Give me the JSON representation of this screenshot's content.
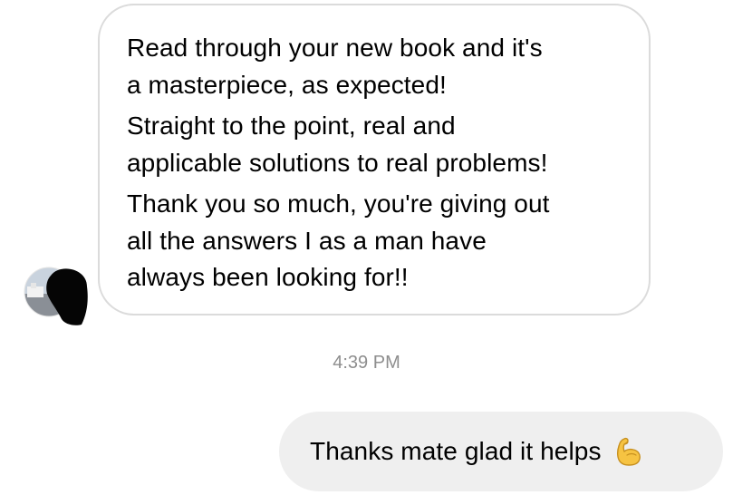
{
  "conversation": {
    "incoming_message": {
      "lines": [
        "Read through your new book and it's",
        "a masterpiece, as expected!",
        "Straight to the point, real and",
        "applicable solutions to real problems!",
        "Thank you so much, you're giving out",
        "all the answers I as a man have",
        "always been looking for!!"
      ]
    },
    "timestamp": "4:39 PM",
    "outgoing_message": {
      "text": "Thanks mate glad it helps",
      "emoji": "flexed-biceps-icon"
    }
  },
  "colors": {
    "incoming_border": "#dbdbdb",
    "outgoing_background": "#efefef",
    "timestamp": "#8e8e8e",
    "emoji": "#f6c342"
  }
}
